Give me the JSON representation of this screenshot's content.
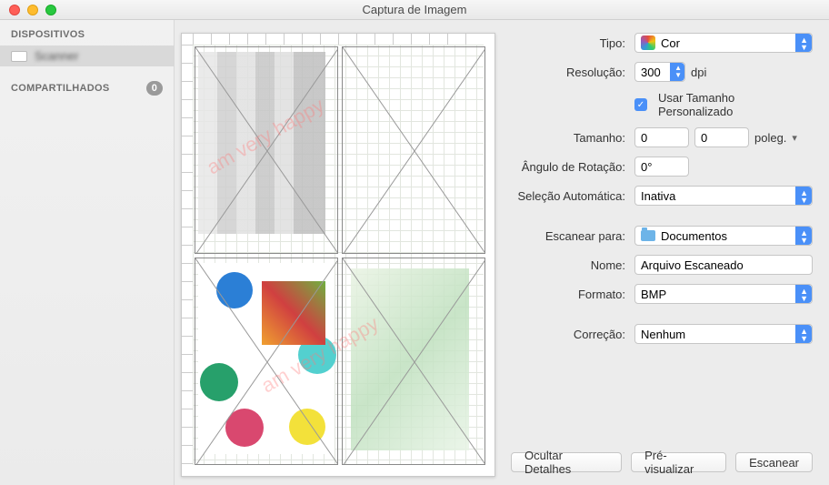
{
  "window": {
    "title": "Captura de Imagem"
  },
  "sidebar": {
    "devices_header": "DISPOSITIVOS",
    "shared_header": "COMPARTILHADOS",
    "shared_count": "0",
    "device_item": "Scanner"
  },
  "form": {
    "tipo": {
      "label": "Tipo:",
      "value": "Cor"
    },
    "resolucao": {
      "label": "Resolução:",
      "value": "300",
      "unit": "dpi"
    },
    "custom_size": {
      "label": "Usar Tamanho Personalizado"
    },
    "tamanho": {
      "label": "Tamanho:",
      "w": "0",
      "h": "0",
      "unit": "poleg."
    },
    "angulo": {
      "label": "Ângulo de Rotação:",
      "value": "0°"
    },
    "selecao": {
      "label": "Seleção Automática:",
      "value": "Inativa"
    },
    "escanear_para": {
      "label": "Escanear para:",
      "value": "Documentos"
    },
    "nome": {
      "label": "Nome:",
      "value": "Arquivo Escaneado"
    },
    "formato": {
      "label": "Formato:",
      "value": "BMP"
    },
    "correcao": {
      "label": "Correção:",
      "value": "Nenhum"
    }
  },
  "buttons": {
    "hide": "Ocultar Detalhes",
    "preview": "Pré-visualizar",
    "scan": "Escanear"
  }
}
